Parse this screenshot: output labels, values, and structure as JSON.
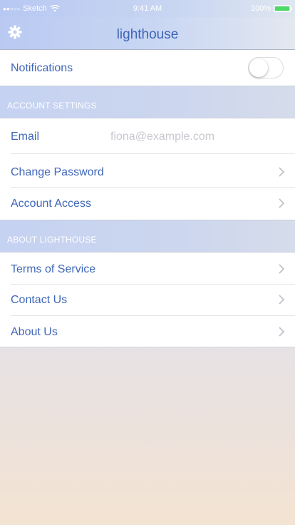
{
  "status_bar": {
    "carrier": "Sketch",
    "time": "9:41 AM",
    "battery": "100%"
  },
  "nav": {
    "title": "lighthouse",
    "settings_icon": "gear-icon"
  },
  "notifications": {
    "label": "Notifications",
    "enabled": false
  },
  "account_settings": {
    "header": "ACCOUNT SETTINGS",
    "email_label": "Email",
    "email_placeholder": "fiona@example.com",
    "items": [
      {
        "label": "Change Password"
      },
      {
        "label": "Account Access"
      }
    ]
  },
  "about": {
    "header": "ABOUT LIGHTHOUSE",
    "items": [
      {
        "label": "Terms of Service"
      },
      {
        "label": "Contact Us"
      },
      {
        "label": "About Us"
      }
    ]
  },
  "colors": {
    "accent": "#3f67b8",
    "toggle_off": "#ffffff",
    "battery": "#4cd964"
  }
}
